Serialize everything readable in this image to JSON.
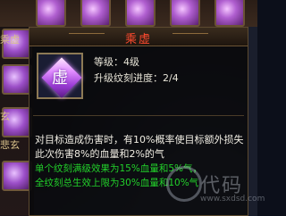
{
  "background": {
    "side_labels": [
      "乘虚",
      "玄",
      "悲玄"
    ]
  },
  "tooltip": {
    "title": "乘虚",
    "icon_char": "虚",
    "level_line": "等级：4级",
    "progress_line": "升级纹刻进度：2/4",
    "description": "对目标造成伤害时，有10%概率使目标额外损失此次伤害8%的血量和2%的气",
    "green_lines": [
      "单个纹刻满级效果为15%血量和5%气，",
      "全纹刻总生效上限为30%血量和10%气"
    ]
  },
  "watermark": {
    "text": "代码",
    "url": "www.sxdsd.com"
  },
  "colors": {
    "title": "#ff4a2e",
    "effect_text": "#22d02a",
    "panel_border": "#5c4a30"
  }
}
